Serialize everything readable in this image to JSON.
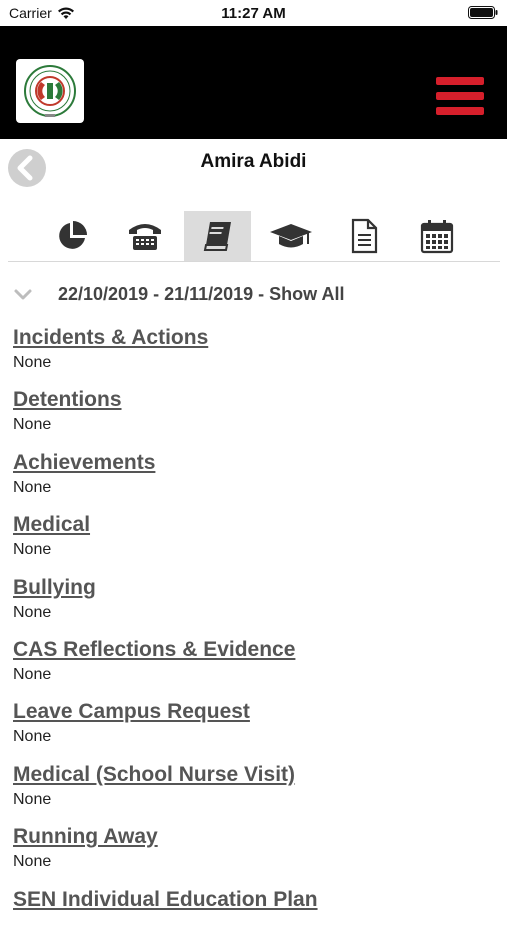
{
  "status_bar": {
    "carrier": "Carrier",
    "time": "11:27 AM"
  },
  "header": {
    "logo_icon": "school-logo-icon",
    "menu_icon": "hamburger-menu-icon",
    "accent_color": "#d61f2b"
  },
  "titlebar": {
    "student_name": "Amira Abidi"
  },
  "tabs": [
    {
      "icon": "pie-chart-icon",
      "active": false
    },
    {
      "icon": "telephone-icon",
      "active": false
    },
    {
      "icon": "book-icon",
      "active": true
    },
    {
      "icon": "graduation-cap-icon",
      "active": false
    },
    {
      "icon": "document-icon",
      "active": false
    },
    {
      "icon": "calendar-icon",
      "active": false
    }
  ],
  "range": {
    "text": "22/10/2019 - 21/11/2019 - Show All"
  },
  "sections": [
    {
      "title": "Incidents & Actions",
      "value": "None"
    },
    {
      "title": "Detentions",
      "value": "None"
    },
    {
      "title": "Achievements",
      "value": "None"
    },
    {
      "title": "Medical",
      "value": "None"
    },
    {
      "title": "Bullying",
      "value": "None"
    },
    {
      "title": "CAS Reflections & Evidence",
      "value": "None"
    },
    {
      "title": "Leave Campus Request",
      "value": "None"
    },
    {
      "title": "Medical (School Nurse Visit)",
      "value": "None"
    },
    {
      "title": "Running Away",
      "value": "None"
    },
    {
      "title": "SEN Individual Education Plan",
      "value": ""
    }
  ]
}
